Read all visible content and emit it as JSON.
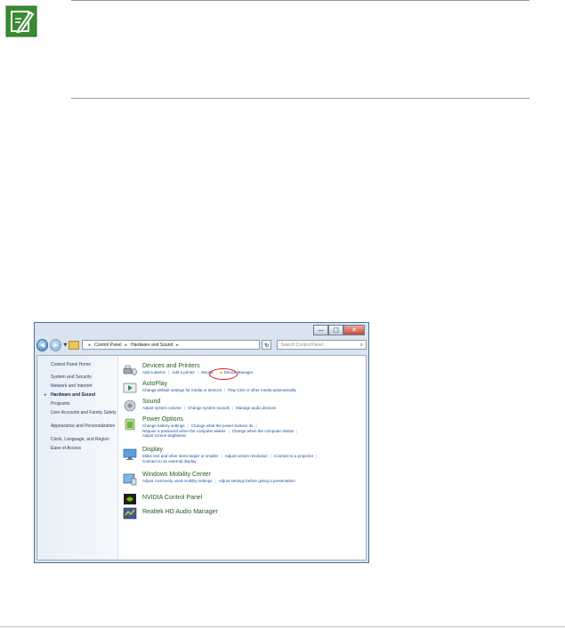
{
  "window": {
    "caption_buttons": [
      "—",
      "□",
      "✕"
    ],
    "breadcrumb": [
      "Control Panel",
      "Hardware and Sound"
    ],
    "search_placeholder": "Search Control Panel"
  },
  "sidebar": {
    "items": [
      {
        "label": "Control Panel Home"
      },
      {
        "label": "System and Security"
      },
      {
        "label": "Network and Internet"
      },
      {
        "label": "Hardware and Sound"
      },
      {
        "label": "Programs"
      },
      {
        "label": "User Accounts and Family Safety"
      },
      {
        "label": "Appearance and Personalization"
      },
      {
        "label": "Clock, Language, and Region"
      },
      {
        "label": "Ease of Access"
      }
    ],
    "active_index": 3
  },
  "categories": [
    {
      "title": "Devices and Printers",
      "links": [
        "Add a device",
        "Add a printer",
        "Mouse",
        "Device Manager"
      ]
    },
    {
      "title": "AutoPlay",
      "links": [
        "Change default settings for media or devices",
        "Play CDs or other media automatically"
      ]
    },
    {
      "title": "Sound",
      "links": [
        "Adjust system volume",
        "Change system sounds",
        "Manage audio devices"
      ]
    },
    {
      "title": "Power Options",
      "links": [
        "Change battery settings",
        "Change what the power buttons do",
        "Require a password when the computer wakes",
        "Change when the computer sleeps",
        "Adjust screen brightness"
      ]
    },
    {
      "title": "Display",
      "links": [
        "Make text and other items larger or smaller",
        "Adjust screen resolution",
        "Connect to a projector",
        "Connect to an external display"
      ]
    },
    {
      "title": "Windows Mobility Center",
      "links": [
        "Adjust commonly used mobility settings",
        "Adjust settings before giving a presentation"
      ]
    },
    {
      "title": "NVIDIA Control Panel"
    },
    {
      "title": "Realtek HD Audio Manager"
    }
  ],
  "icons": {
    "note": "note-pencil-icon",
    "highlight_color": "#e01818",
    "category_title_color": "#1e5f1e",
    "link_color": "#1a4fa0"
  }
}
